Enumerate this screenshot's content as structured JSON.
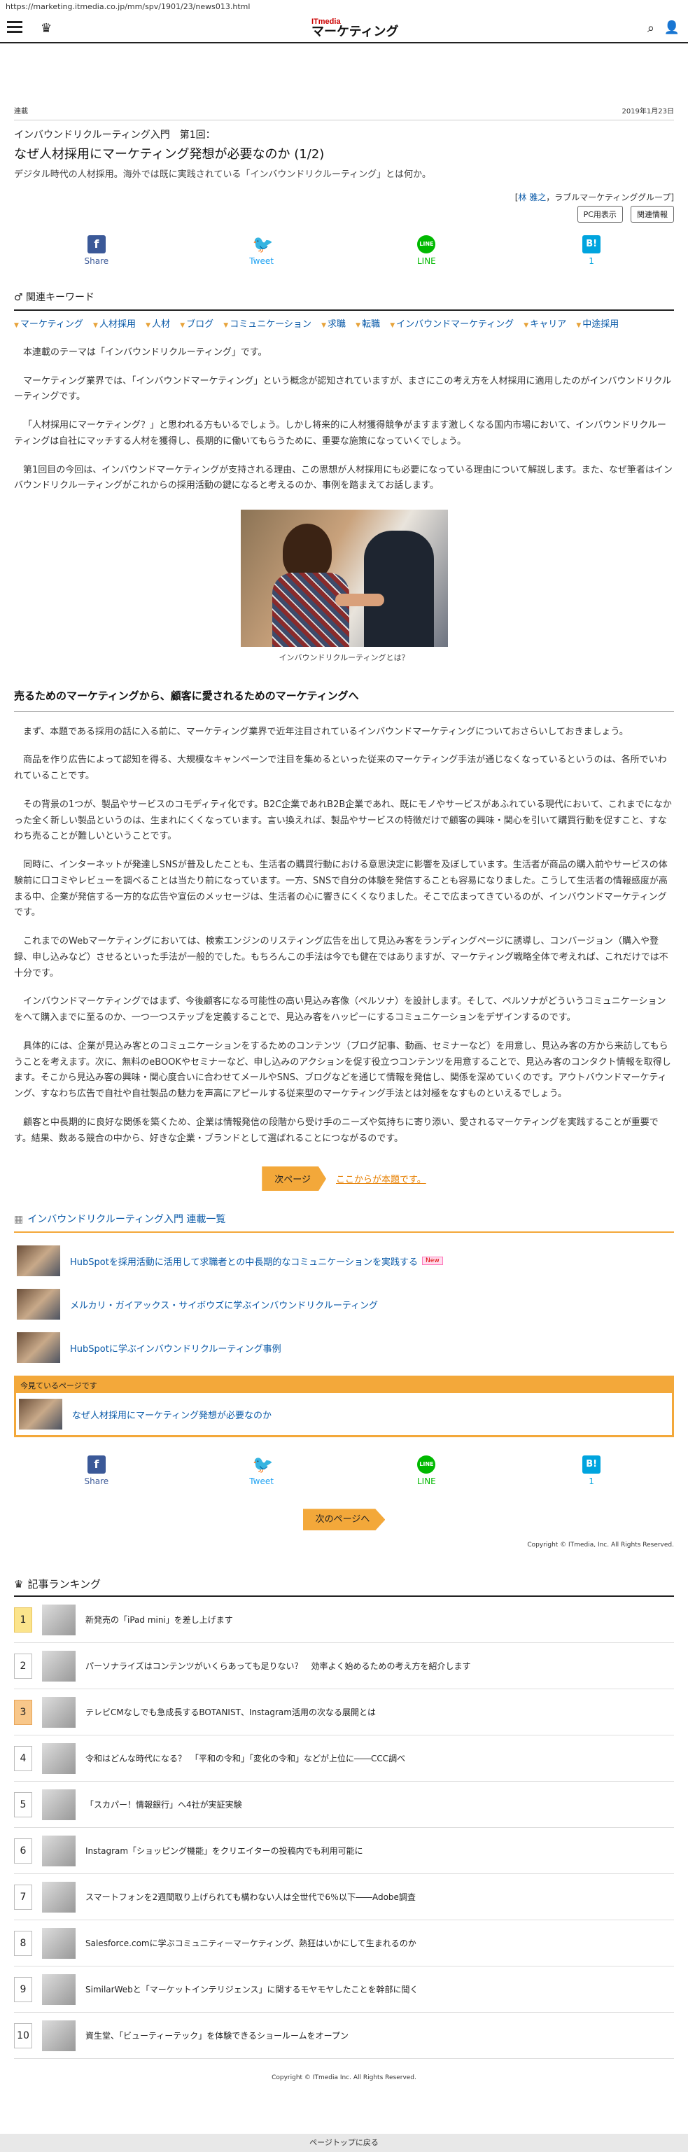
{
  "url": "https://marketing.itmedia.co.jp/mm/spv/1901/23/news013.html",
  "header": {
    "logo_top": "ITmedia",
    "logo_bottom": "マーケティング"
  },
  "article": {
    "category": "連載",
    "date": "2019年1月23日",
    "series": "インバウンドリクルーティング入門　第1回：",
    "title": "なぜ人材採用にマーケティング発想が必要なのか (1/2)",
    "subtitle": "デジタル時代の人材採用。海外では既に実践されている「インバウンドリクルーティング」とは何か。",
    "author_prefix": "[",
    "author": "林 雅之",
    "author_suffix": "，ラブルマーケティンググループ]",
    "pc_label": "PC用表示",
    "related_label": "関連情報"
  },
  "share": {
    "facebook": "Share",
    "twitter": "Tweet",
    "line": "LINE",
    "hatena": "1"
  },
  "keywords": {
    "head": "関連キーワード",
    "items": [
      "マーケティング",
      "人材採用",
      "人材",
      "ブログ",
      "コミュニケーション",
      "求職",
      "転職",
      "インバウンドマーケティング",
      "キャリア",
      "中途採用"
    ]
  },
  "body": {
    "p1": "本連載のテーマは「インバウンドリクルーティング」です。",
    "p2": "マーケティング業界では、「インバウンドマーケティング」という概念が認知されていますが、まさにこの考え方を人材採用に適用したのがインバウンドリクルーティングです。",
    "p3": "「人材採用にマーケティング？」と思われる方もいるでしょう。しかし将来的に人材獲得競争がますます激しくなる国内市場において、インバウンドリクルーティングは自社にマッチする人材を獲得し、長期的に働いてもらうために、重要な施策になっていくでしょう。",
    "p4": "第1回目の今回は、インバウンドマーケティングが支持される理由、この思想が人材採用にも必要になっている理由について解説します。また、なぜ筆者はインバウンドリクルーティングがこれからの採用活動の鍵になると考えるのか、事例を踏まえてお話します。",
    "caption": "インバウンドリクルーティングとは？",
    "section": "売るためのマーケティングから、顧客に愛されるためのマーケティングへ",
    "p5": "まず、本題である採用の話に入る前に、マーケティング業界で近年注目されているインバウンドマーケティングについておさらいしておきましょう。",
    "p6": "商品を作り広告によって認知を得る、大規模なキャンペーンで注目を集めるといった従来のマーケティング手法が通じなくなっているというのは、各所でいわれていることです。",
    "p7": "その背景の1つが、製品やサービスのコモディティ化です。B2C企業であれB2B企業であれ、既にモノやサービスがあふれている現代において、これまでになかった全く新しい製品というのは、生まれにくくなっています。言い換えれば、製品やサービスの特徴だけで顧客の興味・関心を引いて購買行動を促すこと、すなわち売ることが難しいということです。",
    "p8": "同時に、インターネットが発達しSNSが普及したことも、生活者の購買行動における意思決定に影響を及ぼしています。生活者が商品の購入前やサービスの体験前に口コミやレビューを調べることは当たり前になっています。一方、SNSで自分の体験を発信することも容易になりました。こうして生活者の情報感度が高まる中、企業が発信する一方的な広告や宣伝のメッセージは、生活者の心に響きにくくなりました。そこで広まってきているのが、インバウンドマーケティングです。",
    "p9": "これまでのWebマーケティングにおいては、検索エンジンのリスティング広告を出して見込み客をランディングページに誘導し、コンバージョン（購入や登録、申し込みなど）させるといった手法が一般的でした。もちろんこの手法は今でも健在ではありますが、マーケティング戦略全体で考えれば、これだけでは不十分です。",
    "p10": "インバウンドマーケティングではまず、今後顧客になる可能性の高い見込み客像（ペルソナ）を設計します。そして、ペルソナがどういうコミュニケーションをへて購入までに至るのか、一つ一つステップを定義することで、見込み客をハッピーにするコミュニケーションをデザインするのです。",
    "p11": "具体的には、企業が見込み客とのコミュニケーションをするためのコンテンツ（ブログ記事、動画、セミナーなど）を用意し、見込み客の方から来訪してもらうことを考えます。次に、無料のeBOOKやセミナーなど、申し込みのアクションを促す役立つコンテンツを用意することで、見込み客のコンタクト情報を取得します。そこから見込み客の興味・関心度合いに合わせてメールやSNS、ブログなどを通じて情報を発信し、関係を深めていくのです。アウトバウンドマーケティング、すなわち広告で自社や自社製品の魅力を声高にアピールする従来型のマーケティング手法とは対極をなすものといえるでしょう。",
    "p12": "顧客と中長期的に良好な関係を築くため、企業は情報発信の段階から受け手のニーズや気持ちに寄り添い、愛されるマーケティングを実践することが重要です。結果、数ある競合の中から、好きな企業・ブランドとして選ばれることにつながるのです。",
    "next_btn": "次ページ",
    "next_link": "ここからが本題です。"
  },
  "series_list": {
    "head": "インバウンドリクルーティング入門 連載一覧",
    "items": [
      {
        "title": "HubSpotを採用活動に活用して求職者との中長期的なコミュニケーションを実践する",
        "badge": "New"
      },
      {
        "title": "メルカリ・ガイアックス・サイボウズに学ぶインバウンドリクルーティング"
      },
      {
        "title": "HubSpotに学ぶインバウンドリクルーティング事例"
      }
    ],
    "current_label": "今見ているページです",
    "current_title": "なぜ人材採用にマーケティング発想が必要なのか"
  },
  "bottom": {
    "next_page": "次のページへ",
    "copyright": "Copyright © ITmedia, Inc. All Rights Reserved."
  },
  "ranking": {
    "head": "記事ランキング",
    "items": [
      {
        "num": "1",
        "title": "新発売の「iPad mini」を差し上げます"
      },
      {
        "num": "2",
        "title": "パーソナライズはコンテンツがいくらあっても足りない？　効率よく始めるための考え方を紹介します"
      },
      {
        "num": "3",
        "title": "テレビCMなしでも急成長するBOTANIST、Instagram活用の次なる展開とは"
      },
      {
        "num": "4",
        "title": "令和はどんな時代になる？　「平和の令和」「変化の令和」などが上位に――CCC調べ"
      },
      {
        "num": "5",
        "title": "「スカパー！情報銀行」へ4社が実証実験"
      },
      {
        "num": "6",
        "title": "Instagram「ショッピング機能」をクリエイターの投稿内でも利用可能に"
      },
      {
        "num": "7",
        "title": "スマートフォンを2週間取り上げられても構わない人は全世代で6％以下――Adobe調査"
      },
      {
        "num": "8",
        "title": "Salesforce.comに学ぶコミュニティーマーケティング、熱狂はいかにして生まれるのか"
      },
      {
        "num": "9",
        "title": "SimilarWebと「マーケットインテリジェンス」に関するモヤモヤしたことを幹部に聞く"
      },
      {
        "num": "10",
        "title": "資生堂、「ビューティーテック」を体験できるショールームをオープン"
      }
    ],
    "copyright": "Copyright © ITmedia Inc. All Rights Reserved.",
    "back_top": "ページトップに戻る"
  }
}
